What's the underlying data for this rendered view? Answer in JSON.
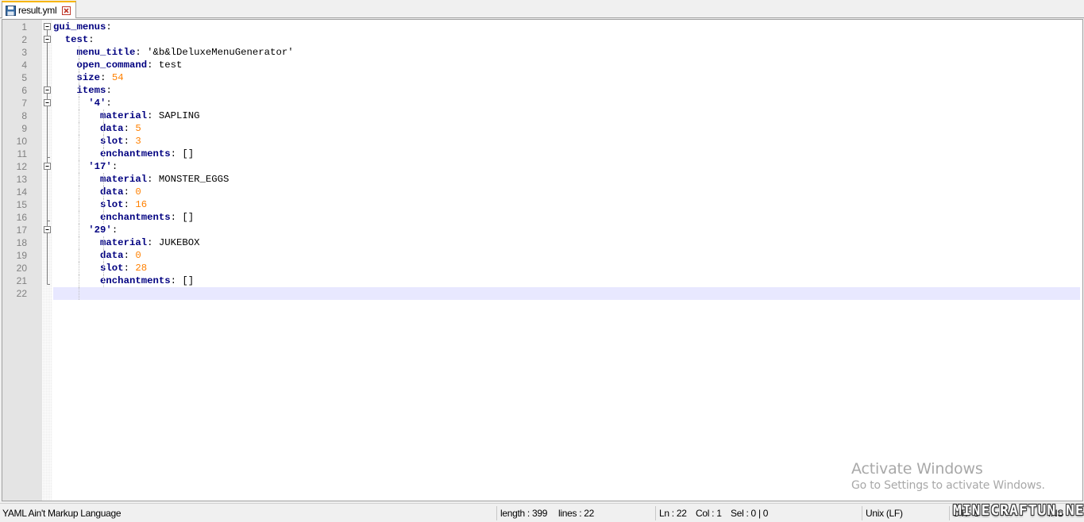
{
  "tab": {
    "label": "result.yml",
    "icon": "floppy-disk-icon",
    "close_icon": "close-icon"
  },
  "editor": {
    "current_line": 22,
    "lines": [
      {
        "num": "1",
        "indent": 0,
        "fold": "minus",
        "tokens": [
          {
            "t": "gui_menus",
            "c": "key"
          },
          {
            "t": ":",
            "c": "plain"
          }
        ]
      },
      {
        "num": "2",
        "indent": 2,
        "fold": "minus",
        "tokens": [
          {
            "t": "test",
            "c": "key"
          },
          {
            "t": ":",
            "c": "plain"
          }
        ]
      },
      {
        "num": "3",
        "indent": 4,
        "fold": "line",
        "tokens": [
          {
            "t": "menu_title",
            "c": "key"
          },
          {
            "t": ": ",
            "c": "plain"
          },
          {
            "t": "'&b&lDeluxeMenuGenerator'",
            "c": "str"
          }
        ]
      },
      {
        "num": "4",
        "indent": 4,
        "fold": "line",
        "tokens": [
          {
            "t": "open_command",
            "c": "key"
          },
          {
            "t": ": ",
            "c": "plain"
          },
          {
            "t": "test",
            "c": "str"
          }
        ]
      },
      {
        "num": "5",
        "indent": 4,
        "fold": "line",
        "tokens": [
          {
            "t": "size",
            "c": "key"
          },
          {
            "t": ": ",
            "c": "plain"
          },
          {
            "t": "54",
            "c": "num"
          }
        ]
      },
      {
        "num": "6",
        "indent": 4,
        "fold": "minus",
        "tokens": [
          {
            "t": "items",
            "c": "key"
          },
          {
            "t": ":",
            "c": "plain"
          }
        ]
      },
      {
        "num": "7",
        "indent": 6,
        "fold": "minus",
        "tokens": [
          {
            "t": "'4'",
            "c": "key"
          },
          {
            "t": ":",
            "c": "plain"
          }
        ]
      },
      {
        "num": "8",
        "indent": 8,
        "fold": "line",
        "tokens": [
          {
            "t": "material",
            "c": "key"
          },
          {
            "t": ": ",
            "c": "plain"
          },
          {
            "t": "SAPLING",
            "c": "str"
          }
        ]
      },
      {
        "num": "9",
        "indent": 8,
        "fold": "line",
        "tokens": [
          {
            "t": "data",
            "c": "key"
          },
          {
            "t": ": ",
            "c": "plain"
          },
          {
            "t": "5",
            "c": "num"
          }
        ]
      },
      {
        "num": "10",
        "indent": 8,
        "fold": "line",
        "tokens": [
          {
            "t": "slot",
            "c": "key"
          },
          {
            "t": ": ",
            "c": "plain"
          },
          {
            "t": "3",
            "c": "num"
          }
        ]
      },
      {
        "num": "11",
        "indent": 8,
        "fold": "end",
        "tokens": [
          {
            "t": "enchantments",
            "c": "key"
          },
          {
            "t": ": ",
            "c": "plain"
          },
          {
            "t": "[]",
            "c": "str"
          }
        ]
      },
      {
        "num": "12",
        "indent": 6,
        "fold": "minus",
        "tokens": [
          {
            "t": "'17'",
            "c": "key"
          },
          {
            "t": ":",
            "c": "plain"
          }
        ]
      },
      {
        "num": "13",
        "indent": 8,
        "fold": "line",
        "tokens": [
          {
            "t": "material",
            "c": "key"
          },
          {
            "t": ": ",
            "c": "plain"
          },
          {
            "t": "MONSTER_EGGS",
            "c": "str"
          }
        ]
      },
      {
        "num": "14",
        "indent": 8,
        "fold": "line",
        "tokens": [
          {
            "t": "data",
            "c": "key"
          },
          {
            "t": ": ",
            "c": "plain"
          },
          {
            "t": "0",
            "c": "num"
          }
        ]
      },
      {
        "num": "15",
        "indent": 8,
        "fold": "line",
        "tokens": [
          {
            "t": "slot",
            "c": "key"
          },
          {
            "t": ": ",
            "c": "plain"
          },
          {
            "t": "16",
            "c": "num"
          }
        ]
      },
      {
        "num": "16",
        "indent": 8,
        "fold": "end",
        "tokens": [
          {
            "t": "enchantments",
            "c": "key"
          },
          {
            "t": ": ",
            "c": "plain"
          },
          {
            "t": "[]",
            "c": "str"
          }
        ]
      },
      {
        "num": "17",
        "indent": 6,
        "fold": "minus",
        "tokens": [
          {
            "t": "'29'",
            "c": "key"
          },
          {
            "t": ":",
            "c": "plain"
          }
        ]
      },
      {
        "num": "18",
        "indent": 8,
        "fold": "line",
        "tokens": [
          {
            "t": "material",
            "c": "key"
          },
          {
            "t": ": ",
            "c": "plain"
          },
          {
            "t": "JUKEBOX",
            "c": "str"
          }
        ]
      },
      {
        "num": "19",
        "indent": 8,
        "fold": "line",
        "tokens": [
          {
            "t": "data",
            "c": "key"
          },
          {
            "t": ": ",
            "c": "plain"
          },
          {
            "t": "0",
            "c": "num"
          }
        ]
      },
      {
        "num": "20",
        "indent": 8,
        "fold": "line",
        "tokens": [
          {
            "t": "slot",
            "c": "key"
          },
          {
            "t": ": ",
            "c": "plain"
          },
          {
            "t": "28",
            "c": "num"
          }
        ]
      },
      {
        "num": "21",
        "indent": 8,
        "fold": "lastend",
        "tokens": [
          {
            "t": "enchantments",
            "c": "key"
          },
          {
            "t": ": ",
            "c": "plain"
          },
          {
            "t": "[]",
            "c": "str"
          }
        ]
      },
      {
        "num": "22",
        "indent": 0,
        "fold": "none",
        "tokens": []
      }
    ]
  },
  "watermark": {
    "title": "Activate Windows",
    "subtitle": "Go to Settings to activate Windows."
  },
  "statusbar": {
    "language": "YAML Ain't Markup Language",
    "length": "length : 399",
    "lines": "lines : 22",
    "ln": "Ln : 22",
    "col": "Col : 1",
    "sel": "Sel : 0 | 0",
    "eol": "Unix (LF)",
    "encoding": "UTF-8",
    "mode": "INS"
  },
  "brand": "MINECRAFTUN.NET",
  "colors": {
    "key": "#000080",
    "number": "#ff8000",
    "current_line": "#e8e8ff",
    "tab_accent": "#f7b500"
  }
}
